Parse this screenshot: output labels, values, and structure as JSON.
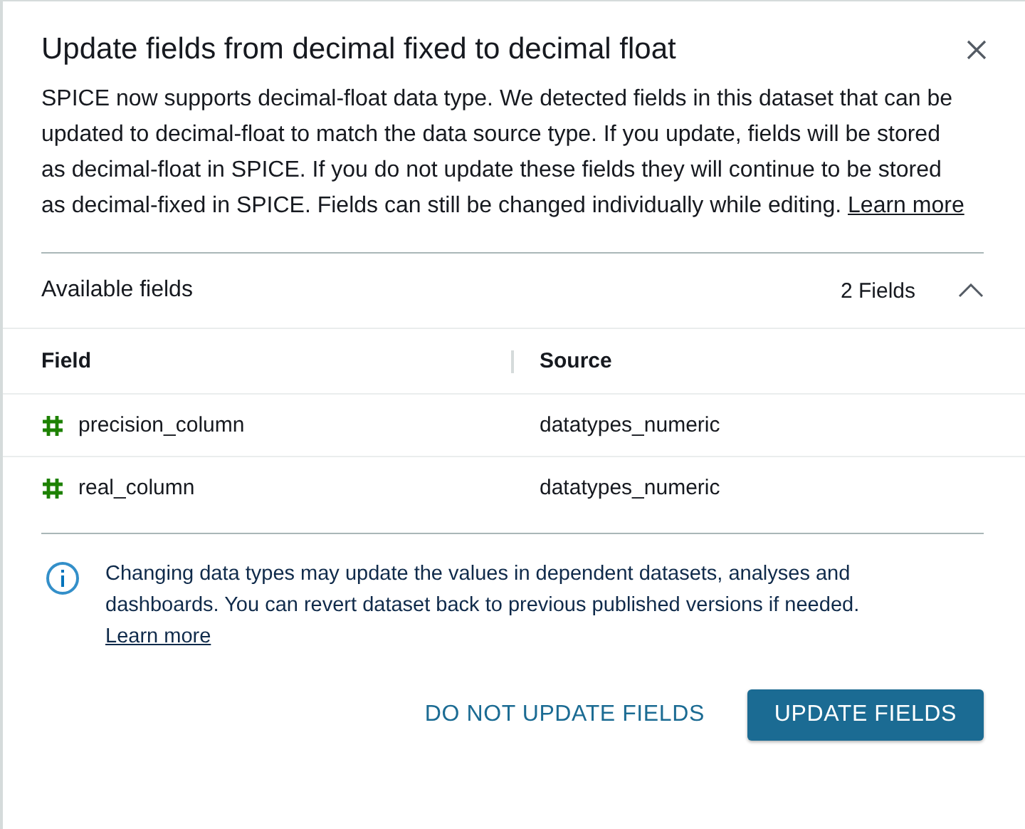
{
  "dialog": {
    "title": "Update fields from decimal fixed to decimal float",
    "description": "SPICE now supports decimal-float data type. We detected fields in this dataset that can be updated to decimal-float to match the data source type. If you update, fields will be stored as decimal-float in SPICE. If you do not update these fields they will continue to be stored as decimal-fixed in SPICE. Fields can still be changed individually while editing.",
    "description_link": "Learn more"
  },
  "section": {
    "title": "Available fields",
    "count": "2 Fields",
    "expanded": true
  },
  "table": {
    "columns": [
      "Field",
      "Source"
    ],
    "rows": [
      {
        "field": "precision_column",
        "source": "datatypes_numeric"
      },
      {
        "field": "real_column",
        "source": "datatypes_numeric"
      }
    ]
  },
  "notice": {
    "text": "Changing data types may update the values in dependent datasets, analyses and dashboards. You can revert dataset back to previous published versions if needed.",
    "link": "Learn more"
  },
  "buttons": [
    {
      "label": "DO NOT UPDATE FIELDS",
      "kind": "secondary"
    },
    {
      "label": "UPDATE FIELDS",
      "kind": "primary"
    }
  ]
}
